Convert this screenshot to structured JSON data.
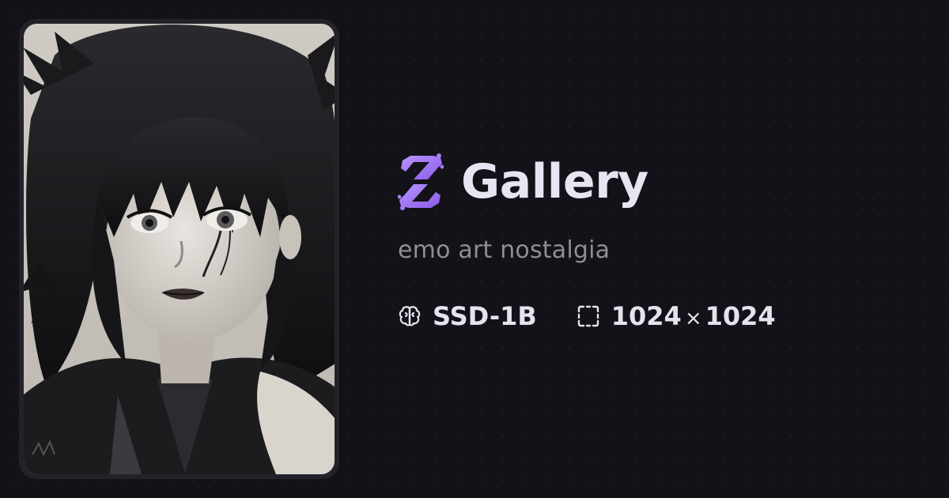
{
  "card": {
    "image_subject": "portrait-illustration"
  },
  "header": {
    "logo_icon": "gallery-logo-icon",
    "title": "Gallery"
  },
  "prompt": {
    "text": "emo art nostalgia"
  },
  "meta": {
    "model": {
      "icon": "brain-icon",
      "label": "SSD-1B"
    },
    "size": {
      "icon": "dashed-square-icon",
      "width": "1024",
      "separator": "×",
      "height": "1024"
    }
  },
  "colors": {
    "background": "#131218",
    "accent": "#9b6cf2",
    "title": "#e8e4f2",
    "muted": "#8f8d96"
  }
}
